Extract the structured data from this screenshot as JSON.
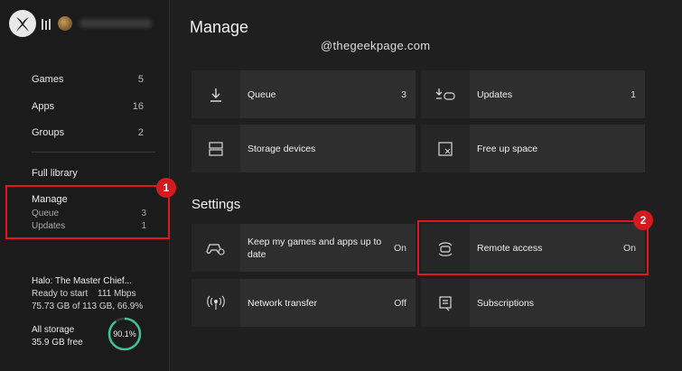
{
  "sidebar": {
    "nav": [
      {
        "label": "Games",
        "count": "5"
      },
      {
        "label": "Apps",
        "count": "16"
      },
      {
        "label": "Groups",
        "count": "2"
      }
    ],
    "full_library": "Full library",
    "manage": {
      "title": "Manage",
      "sub": [
        {
          "label": "Queue",
          "count": "3"
        },
        {
          "label": "Updates",
          "count": "1"
        }
      ]
    },
    "game": {
      "title": "Halo: The Master Chief...",
      "status": "Ready to start",
      "speed": "111 Mbps",
      "progress": "75.73 GB of 113 GB, 66.9%"
    },
    "storage": {
      "label": "All storage",
      "free": "35.9 GB free",
      "percent_label": "90.1%",
      "percent_value": 90.1
    }
  },
  "badges": {
    "one": "1",
    "two": "2"
  },
  "main": {
    "title": "Manage",
    "watermark": "@thegeekpage.com",
    "tiles": [
      {
        "label": "Queue",
        "value": "3",
        "icon": "download-icon"
      },
      {
        "label": "Updates",
        "value": "1",
        "icon": "updates-icon"
      },
      {
        "label": "Storage devices",
        "value": "",
        "icon": "storage-icon"
      },
      {
        "label": "Free up space",
        "value": "",
        "icon": "free-space-icon"
      }
    ],
    "settings_title": "Settings",
    "settings": [
      {
        "label": "Keep my games and apps up to date",
        "value": "On",
        "icon": "controller-gear-icon"
      },
      {
        "label": "Remote access",
        "value": "On",
        "icon": "remote-access-icon"
      },
      {
        "label": "Network transfer",
        "value": "Off",
        "icon": "network-transfer-icon"
      },
      {
        "label": "Subscriptions",
        "value": "",
        "icon": "subscriptions-icon"
      }
    ]
  },
  "colors": {
    "accent_red": "#e0171d",
    "storage_ring": "#3fbf9a"
  }
}
